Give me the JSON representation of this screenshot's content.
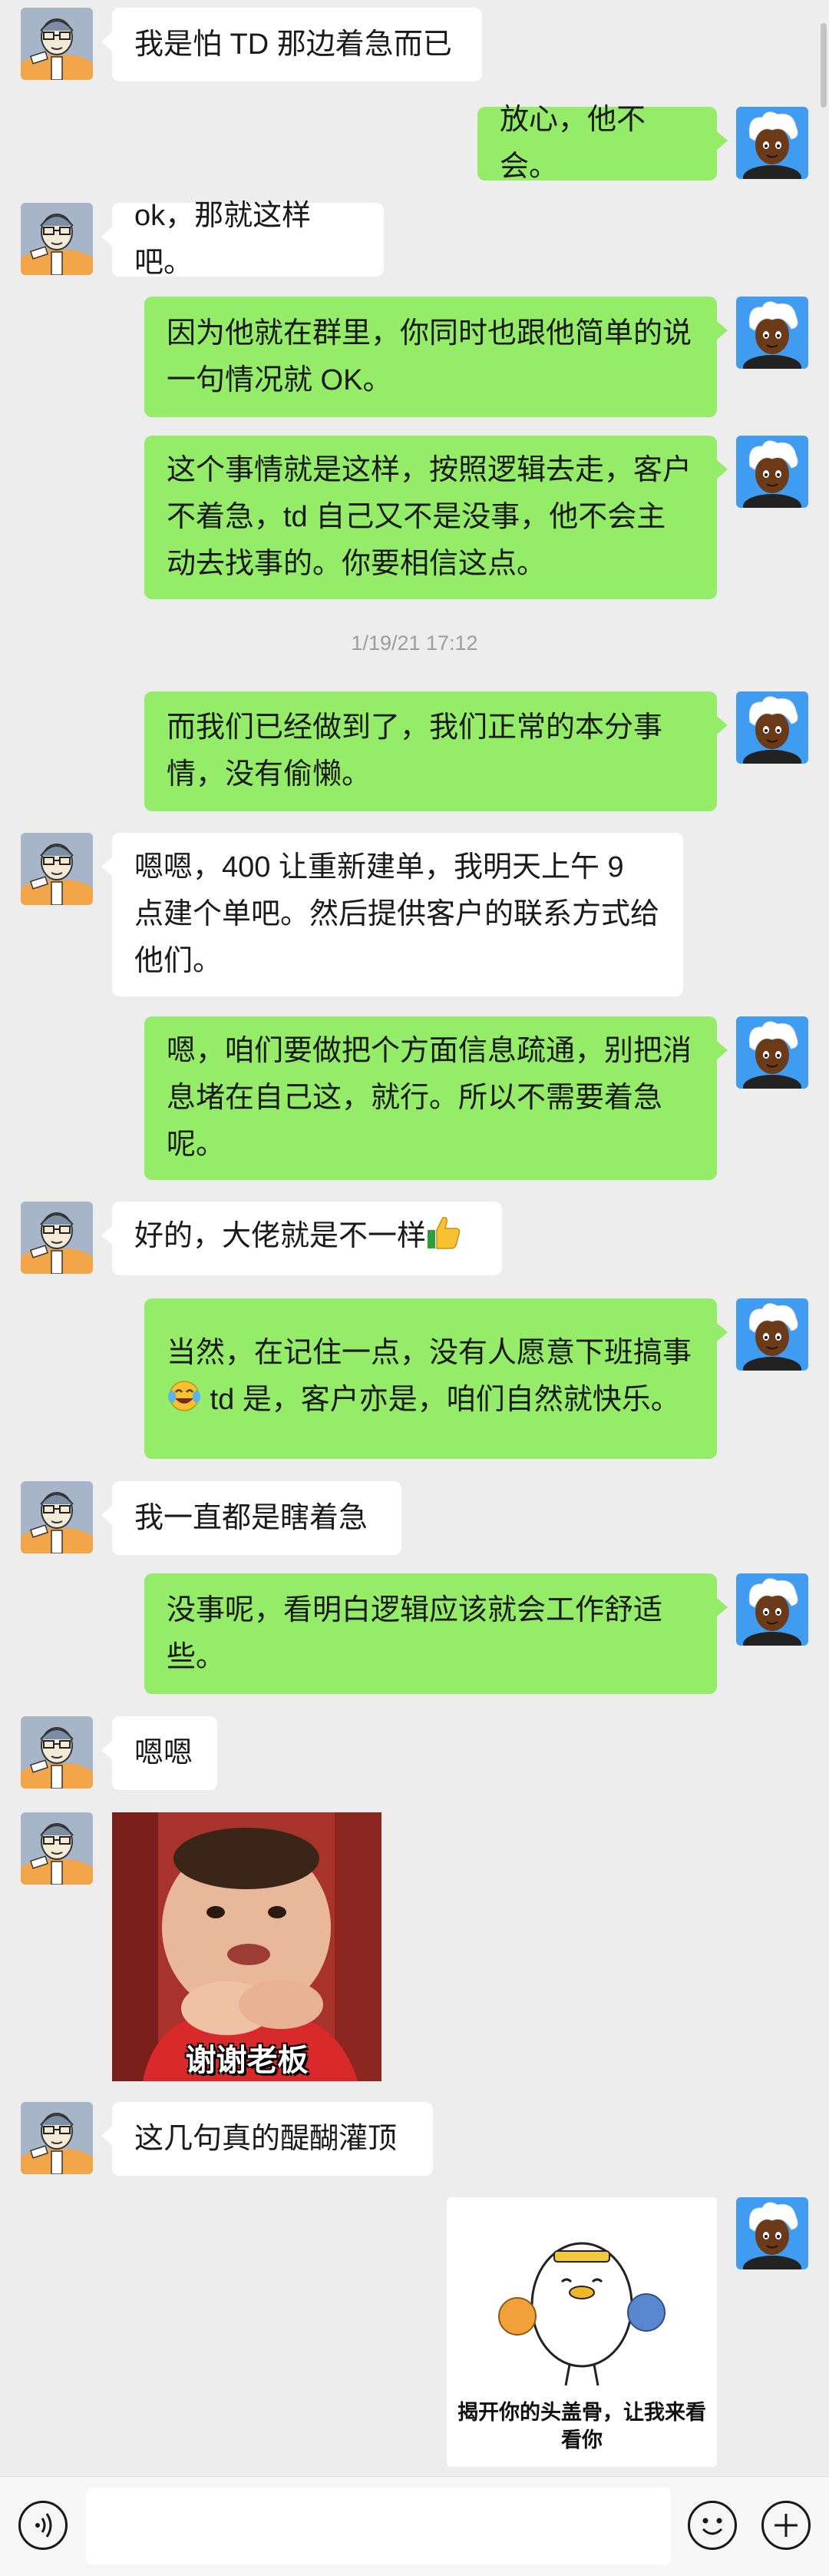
{
  "chat": {
    "messages": [
      {
        "text": "我是怕 TD 那边着急而已"
      },
      {
        "text": "放心，他不会。"
      },
      {
        "text": "ok，那就这样吧。"
      },
      {
        "text": "因为他就在群里，你同时也跟他简单的说一句情况就 OK。"
      },
      {
        "text": "这个事情就是这样，按照逻辑去走，客户不着急，td 自己又不是没事，他不会主动去找事的。你要相信这点。"
      },
      {
        "text": "而我们已经做到了，我们正常的本分事情，没有偷懒。"
      },
      {
        "text": "嗯嗯，400 让重新建单，我明天上午 9 点建个单吧。然后提供客户的联系方式给他们。"
      },
      {
        "text": "嗯，咱们要做把个方面信息疏通，别把消息堵在自己这，就行。所以不需要着急呢。"
      },
      {
        "text": "好的，大佬就是不一样",
        "emoji": "thumbs-up-icon"
      },
      {
        "text_before": "当然，在记住一点，没有人愿意下班搞事",
        "emoji": "tears-of-joy-icon",
        "text_after": " td 是，客户亦是，咱们自然就快乐。"
      },
      {
        "text": "我一直都是瞎着急"
      },
      {
        "text": "没事呢，看明白逻辑应该就会工作舒适些。"
      },
      {
        "text": "嗯嗯"
      },
      {
        "sticker_caption": "谢谢老板"
      },
      {
        "text": "这几句真的醍醐灌顶"
      },
      {
        "sticker_caption": "揭开你的头盖骨，让我来看看你"
      }
    ],
    "timestamp": "1/19/21 17:12"
  },
  "input_bar": {
    "placeholder": "",
    "voice_icon": "voice-icon",
    "emoji_icon": "emoji-icon",
    "plus_icon": "plus-icon"
  },
  "colors": {
    "background": "#ededed",
    "my_bubble": "#95ec69",
    "their_bubble": "#ffffff",
    "timestamp": "#9d9d9d"
  }
}
